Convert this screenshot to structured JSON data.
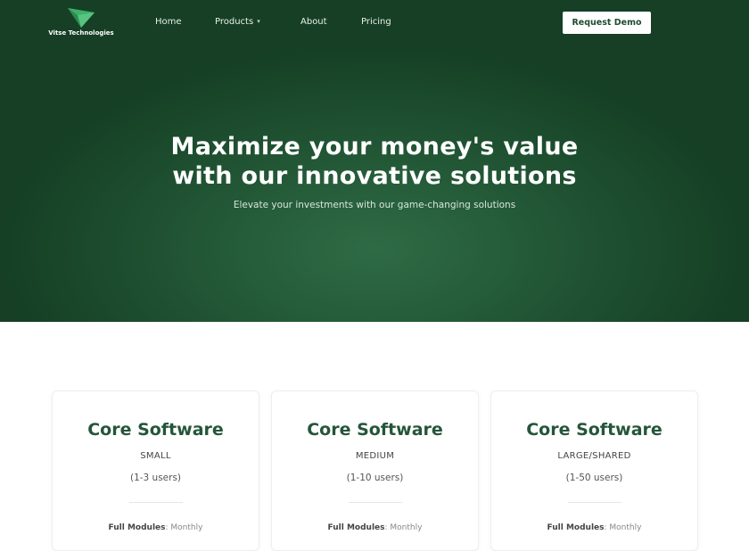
{
  "brand": {
    "name": "Vitse Technologies",
    "logo_icon": "v-arrow-logo-icon",
    "accent": "#3fb06a"
  },
  "nav": {
    "items": [
      {
        "label": "Home"
      },
      {
        "label": "Products",
        "icon": "chevron-down-icon"
      },
      {
        "label": "About"
      },
      {
        "label": "Pricing"
      }
    ],
    "cta": "Request Demo"
  },
  "hero": {
    "title_line1": "Maximize your money's value",
    "title_line2": "with our innovative solutions",
    "subtitle": "Elevate your investments with our game-changing solutions",
    "bg_color": "#1f4d30"
  },
  "plans": [
    {
      "title": "Core Software",
      "tier": "SMALL",
      "users": "(1-3 users)",
      "modules_label": "Full Modules",
      "modules_value": "Monthly"
    },
    {
      "title": "Core Software",
      "tier": "MEDIUM",
      "users": "(1-10 users)",
      "modules_label": "Full Modules",
      "modules_value": "Monthly"
    },
    {
      "title": "Core Software",
      "tier": "LARGE/SHARED",
      "users": "(1-50 users)",
      "modules_label": "Full Modules",
      "modules_value": "Monthly"
    }
  ]
}
